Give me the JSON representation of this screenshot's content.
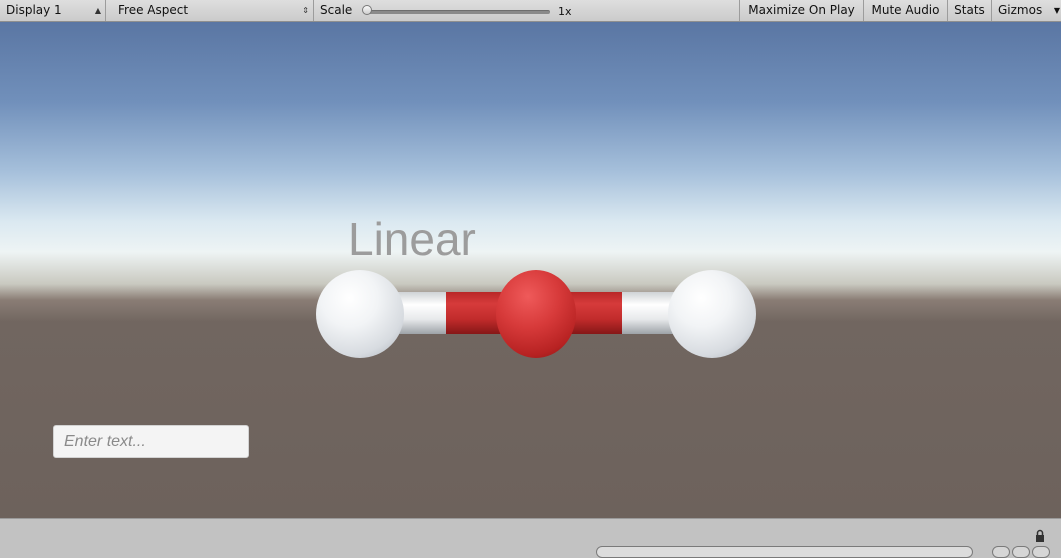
{
  "toolbar": {
    "display": "Display 1",
    "aspect": "Free Aspect",
    "scale_label": "Scale",
    "scale_value": "1x",
    "scale_level": 0.0,
    "maximize_on_play": "Maximize On Play",
    "mute_audio": "Mute Audio",
    "stats": "Stats",
    "gizmos": "Gizmos"
  },
  "scene": {
    "label": "Linear",
    "input_placeholder": "Enter text...",
    "molecule": {
      "atoms": [
        "white",
        "red",
        "white"
      ],
      "colors": {
        "hydrogen": "#eef0f2",
        "oxygen": "#d63b3b",
        "ground": "#6d625c",
        "sky": "#5a76a3"
      }
    }
  },
  "icons": [
    "updown-icon",
    "dropdown-arrow-icon",
    "lock-icon"
  ]
}
